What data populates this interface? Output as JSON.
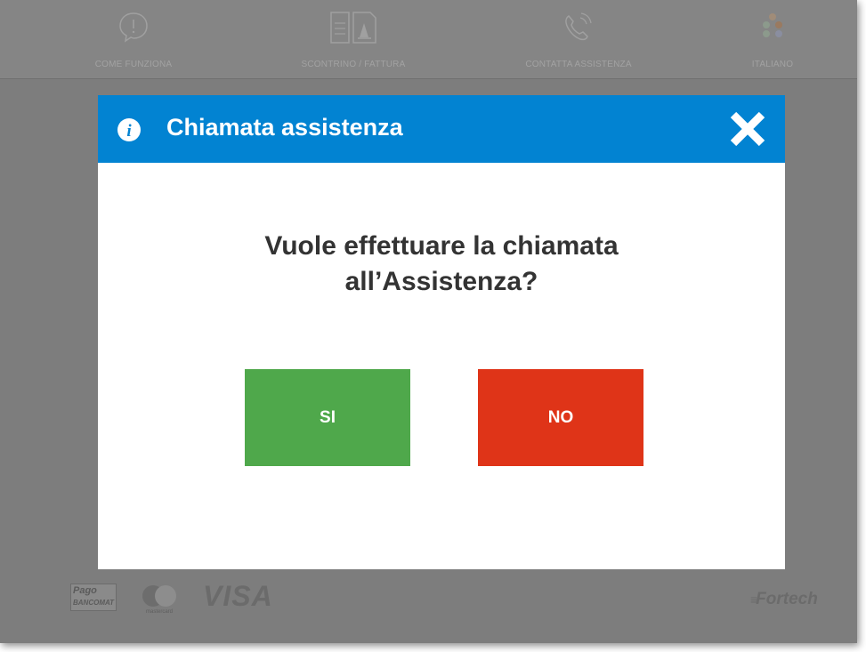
{
  "topbar": {
    "items": [
      {
        "label": "COME FUNZIONA",
        "icon": "info-bubble-icon"
      },
      {
        "label": "SCONTRINO / FATTURA",
        "icon": "receipt-icon"
      },
      {
        "label": "CONTATTA ASSISTENZA",
        "icon": "phone-icon"
      },
      {
        "label": "ITALIANO",
        "icon": "language-flags-icon"
      }
    ]
  },
  "modal": {
    "title": "Chiamata assistenza",
    "question_line1": "Vuole effettuare la chiamata",
    "question_line2": "all’Assistenza?",
    "yes_label": "SI",
    "no_label": "NO",
    "header_color": "#0283d2",
    "yes_color": "#4fa84b",
    "no_color": "#df3418"
  },
  "footer": {
    "payments": {
      "pagobancomat_top": "Pago",
      "pagobancomat_bottom": "BANCOMAT",
      "mastercard": "mastercard",
      "visa": "VISA"
    },
    "brand": "Fortech"
  }
}
